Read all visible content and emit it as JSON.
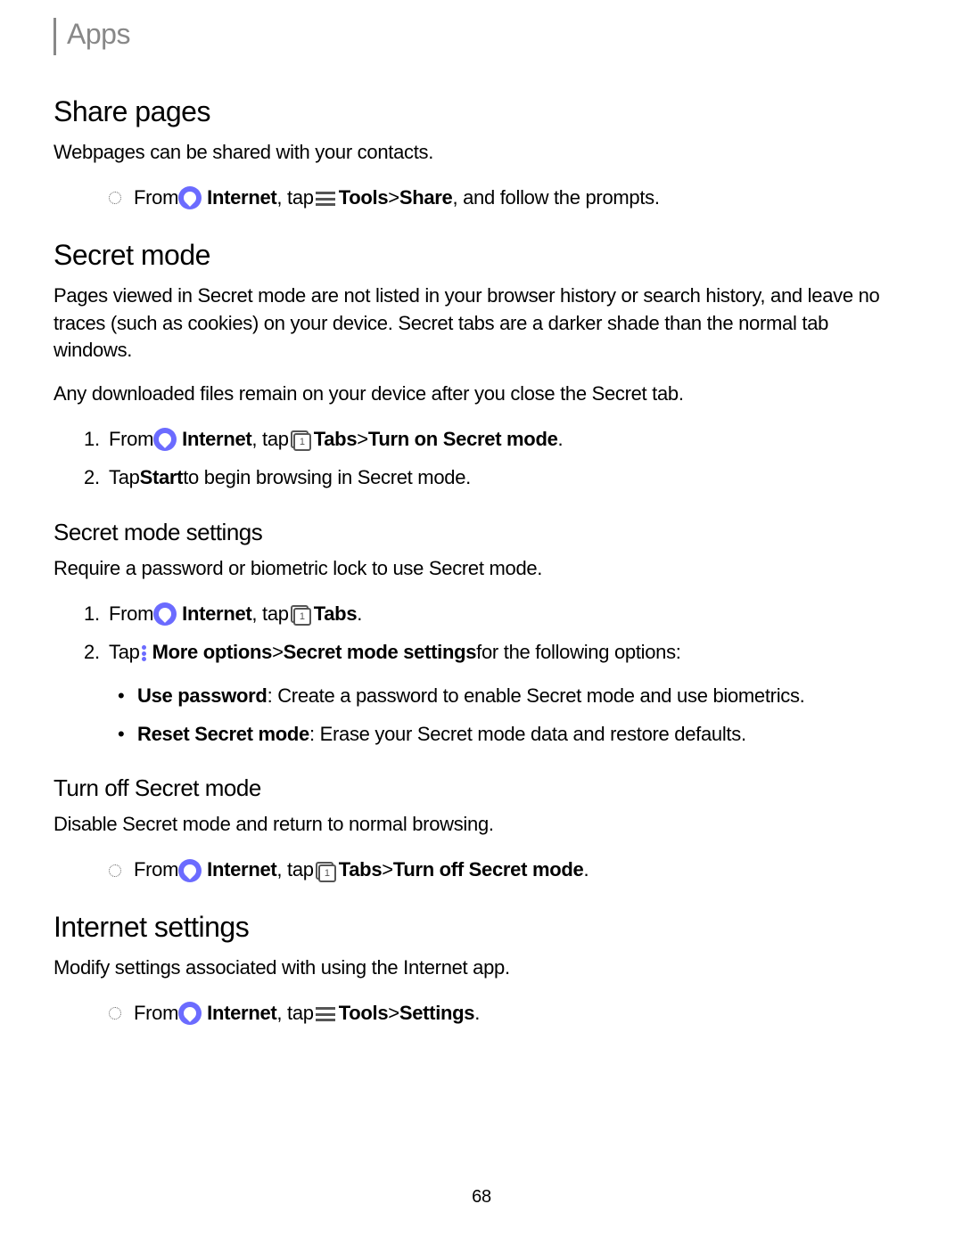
{
  "breadcrumb": "Apps",
  "page_number": "68",
  "share": {
    "title": "Share pages",
    "desc": "Webpages can be shared with your contacts.",
    "step": {
      "from": "From ",
      "internet": "Internet",
      "tap": ", tap ",
      "tools": "Tools",
      "sep": " > ",
      "share": "Share",
      "tail": ", and follow the prompts."
    }
  },
  "secret": {
    "title": "Secret mode",
    "desc1": "Pages viewed in Secret mode are not listed in your browser history or search history, and leave no traces (such as cookies) on your device. Secret tabs are a darker shade than the normal tab windows.",
    "desc2": "Any downloaded files remain on your device after you close the Secret tab.",
    "step1": {
      "from": "From ",
      "internet": "Internet",
      "tap": ", tap ",
      "tabs": "Tabs",
      "sep": " > ",
      "turnon": "Turn on Secret mode",
      "period": "."
    },
    "step2_a": "Tap ",
    "step2_b": "Start",
    "step2_c": " to begin browsing in Secret mode."
  },
  "settings": {
    "title": "Secret mode settings",
    "desc": "Require a password or biometric lock to use Secret mode.",
    "step1": {
      "from": "From ",
      "internet": "Internet",
      "tap": ", tap ",
      "tabs": "Tabs",
      "period": "."
    },
    "step2_a": "Tap ",
    "step2_b": "More options",
    "step2_sep": " > ",
    "step2_c": "Secret mode settings",
    "step2_d": " for the following options:",
    "sub1_a": "Use password",
    "sub1_b": ": Create a password to enable Secret mode and use biometrics.",
    "sub2_a": "Reset Secret mode",
    "sub2_b": ": Erase your Secret mode data and restore defaults."
  },
  "turnoff": {
    "title": "Turn off Secret mode",
    "desc": "Disable Secret mode and return to normal browsing.",
    "step": {
      "from": "From ",
      "internet": "Internet",
      "tap": ", tap ",
      "tabs": "Tabs",
      "sep": " > ",
      "off": "Turn off Secret mode",
      "period": "."
    }
  },
  "internet_settings": {
    "title": "Internet settings",
    "desc": "Modify settings associated with using the Internet app.",
    "step": {
      "from": "From ",
      "internet": "Internet",
      "tap": ", tap ",
      "tools": "Tools",
      "sep": " > ",
      "settings": "Settings",
      "period": "."
    }
  }
}
